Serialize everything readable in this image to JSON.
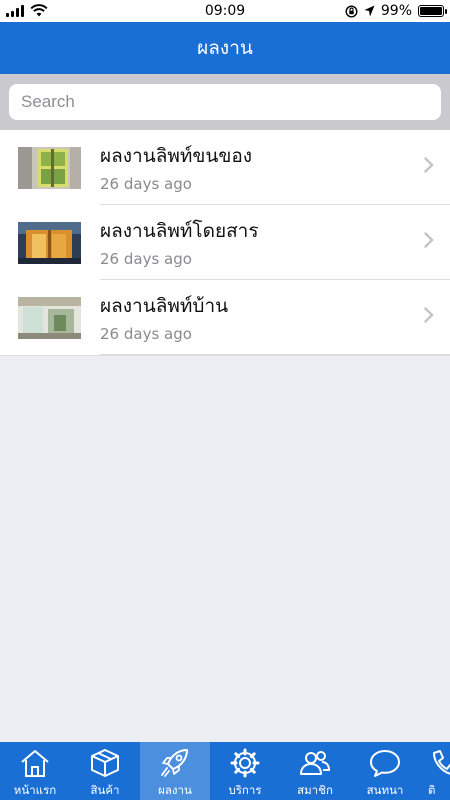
{
  "status_bar": {
    "time": "09:09",
    "battery_text": "99%",
    "battery_level": 0.99
  },
  "header": {
    "title": "ผลงาน"
  },
  "search": {
    "placeholder": "Search"
  },
  "list": {
    "items": [
      {
        "title": "ผลงานลิพท์ขนของ",
        "subtitle": "26 days ago"
      },
      {
        "title": "ผลงานลิพท์โดยสาร",
        "subtitle": "26 days ago"
      },
      {
        "title": "ผลงานลิพท์บ้าน",
        "subtitle": "26 days ago"
      }
    ]
  },
  "tabs": [
    {
      "label": "หน้าแรก",
      "icon": "home-icon"
    },
    {
      "label": "สินค้า",
      "icon": "box-icon"
    },
    {
      "label": "ผลงาน",
      "icon": "rocket-icon",
      "active": true
    },
    {
      "label": "บริการ",
      "icon": "gear-icon"
    },
    {
      "label": "สมาชิก",
      "icon": "users-icon"
    },
    {
      "label": "สนทนา",
      "icon": "chat-bubble-icon"
    },
    {
      "label": "ติ",
      "icon": "phone-icon"
    }
  ],
  "colors": {
    "primary": "#1a6fd4",
    "active_tab": "#4b8fde",
    "background": "#eceef3"
  }
}
